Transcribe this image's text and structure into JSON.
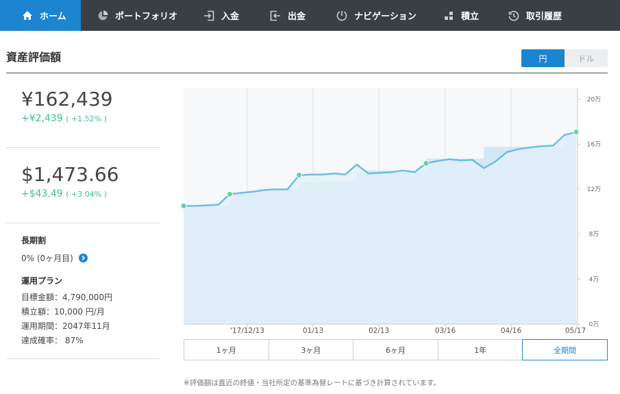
{
  "nav": {
    "items": [
      {
        "label": "ホーム",
        "icon": "home-icon",
        "active": true
      },
      {
        "label": "ポートフォリオ",
        "icon": "pie-chart-icon"
      },
      {
        "label": "入金",
        "icon": "deposit-icon"
      },
      {
        "label": "出金",
        "icon": "withdraw-icon"
      },
      {
        "label": "ナビゲーション",
        "icon": "navigation-icon"
      },
      {
        "label": "積立",
        "icon": "grid-icon"
      },
      {
        "label": "取引履歴",
        "icon": "history-icon"
      }
    ]
  },
  "title": "資産評価額",
  "currency_toggle": {
    "jpy": "円",
    "usd": "ドル",
    "selected": "円"
  },
  "jpy": {
    "value": "¥162,439",
    "gain": "+¥2,439",
    "gain_pct": "( +1.52% )"
  },
  "usd": {
    "value": "$1,473.66",
    "gain": "+$43.49",
    "gain_pct": "( +3.04% )"
  },
  "long_term": {
    "label": "長期割",
    "value": "0% (0ヶ月目)"
  },
  "plan": {
    "label": "運用プラン",
    "target": "目標金額：4,790,000円",
    "monthly": "積立額：10,000 円/月",
    "period": "運用期間：2047年11月",
    "probability": "達成確率： 87%"
  },
  "chart_data": {
    "type": "area",
    "x_ticks": [
      "'17/12/13",
      "01/13",
      "02/13",
      "03/16",
      "04/16",
      "05/17"
    ],
    "y_ticks": [
      "0万",
      "4万",
      "8万",
      "12万",
      "16万",
      "20万"
    ],
    "ylim": [
      0,
      200000
    ],
    "series": [
      {
        "values": [
          100000,
          100000,
          100500,
          101000,
          110000,
          111000,
          112000,
          113500,
          114000,
          114000,
          126000,
          126500,
          126500,
          127500,
          126500,
          135000,
          127500,
          128000,
          128500,
          130000,
          128500,
          136000,
          138000,
          139500,
          138500,
          139000,
          132000,
          137500,
          145500,
          148000,
          149500,
          150500,
          151000,
          160000,
          162439
        ]
      },
      {
        "values": [
          100000,
          100000,
          100000,
          100000,
          110000,
          110000,
          112000,
          113000,
          114000,
          114000,
          120000,
          120000,
          120000,
          121000,
          121000,
          130000,
          130000,
          130000,
          130000,
          130000,
          130000,
          140000,
          140000,
          140000,
          140000,
          140000,
          150000,
          150000,
          150000,
          150000,
          150000,
          150000,
          150000,
          160000,
          160000
        ]
      }
    ],
    "deposit_points": [
      0,
      4,
      10,
      21,
      34
    ],
    "colors": {
      "line": "#6bbde3",
      "fill": "#e3f0f8",
      "marker": "#5ed3a2"
    }
  },
  "periods": {
    "selected": "全期間",
    "labels": [
      "1ヶ月",
      "3ヶ月",
      "6ヶ月",
      "1年",
      "全期間"
    ]
  },
  "footnote": "※評価額は直近の終値・当社所定の基準為替レートに基づき計算されています。"
}
